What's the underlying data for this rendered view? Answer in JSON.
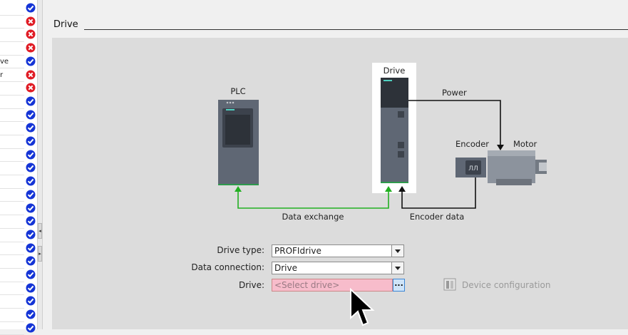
{
  "nav": {
    "rows": [
      "",
      "",
      "",
      "",
      "ve",
      "r",
      "",
      "",
      "",
      "",
      "",
      "",
      "",
      "",
      "",
      "",
      "",
      "",
      "",
      "",
      "",
      "",
      "",
      "",
      ""
    ]
  },
  "status_icons": [
    "check",
    "error",
    "error",
    "error",
    "check",
    "error",
    "error",
    "check",
    "check",
    "check",
    "check",
    "check",
    "check",
    "check",
    "check",
    "check",
    "check",
    "check",
    "check",
    "check",
    "check",
    "check",
    "check",
    "check",
    "check"
  ],
  "colors": {
    "check": "#1434d6",
    "error": "#e01b24",
    "green_line": "#22b022",
    "black_line": "#111111"
  },
  "section": {
    "title": "Drive"
  },
  "diagram": {
    "plc_label": "PLC",
    "drive_label": "Drive",
    "power_label": "Power",
    "encoder_label": "Encoder",
    "motor_label": "Motor",
    "data_exchange_label": "Data exchange",
    "encoder_data_label": "Encoder data",
    "encoder_symbol": "ЛЛ"
  },
  "form": {
    "drive_type_label": "Drive type:",
    "drive_type_value": "PROFIdrive",
    "data_connection_label": "Data connection:",
    "data_connection_value": "Drive",
    "drive_label": "Drive:",
    "drive_placeholder": "<Select drive>",
    "browse_label": "...",
    "device_configuration_label": "Device configuration"
  }
}
